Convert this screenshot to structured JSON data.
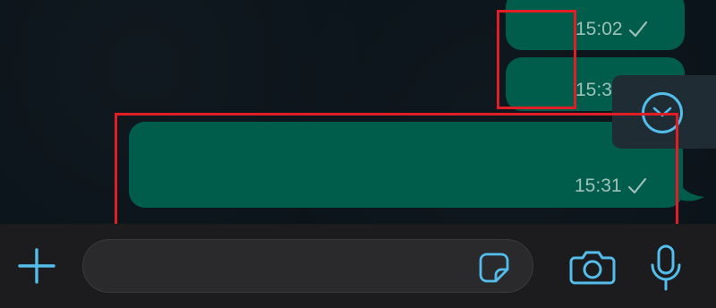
{
  "messages": [
    {
      "time": "15:02",
      "status": "sent"
    },
    {
      "time": "15:3",
      "status": "sent"
    },
    {
      "time": "15:31",
      "status": "sent"
    }
  ],
  "composer": {
    "placeholder": "",
    "icons": [
      "plus-icon",
      "sticker-icon",
      "camera-icon",
      "microphone-icon"
    ]
  },
  "colors": {
    "background": "#0b141a",
    "bubble": "#005c4b",
    "accent": "#53bdeb",
    "composer": "#1c1c1e",
    "highlight": "#e01e26"
  }
}
